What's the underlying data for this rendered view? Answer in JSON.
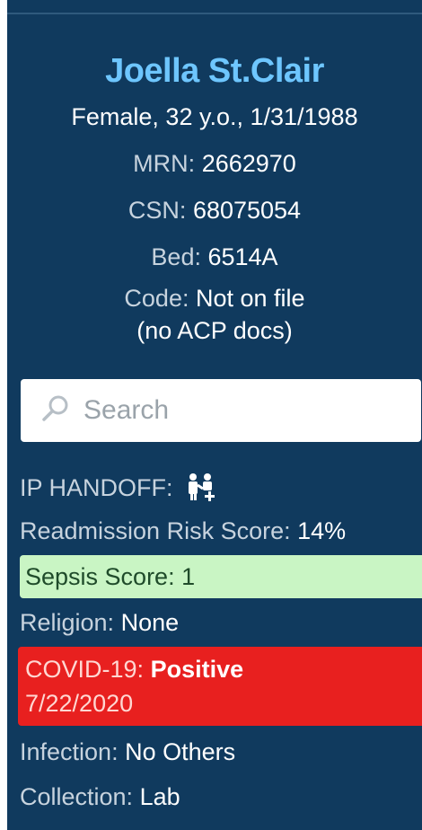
{
  "patient": {
    "name": "Joella St.Clair",
    "demographics": "Female, 32 y.o., 1/31/1988",
    "mrn_label": "MRN:",
    "mrn": "2662970",
    "csn_label": "CSN:",
    "csn": "68075054",
    "bed_label": "Bed:",
    "bed": "6514A",
    "code_label": "Code:",
    "code": "Not on file",
    "code_note": "(no ACP docs)"
  },
  "search": {
    "placeholder": "Search",
    "icon": "search-icon"
  },
  "info": {
    "handoff_label": "IP HANDOFF:",
    "handoff_icon": "handoff-icon",
    "readmission_label": "Readmission Risk Score:",
    "readmission_value": "14%",
    "sepsis_label": "Sepsis Score:",
    "sepsis_value": "1",
    "religion_label": "Religion:",
    "religion_value": "None",
    "covid_label": "COVID-19:",
    "covid_value": "Positive",
    "covid_date": "7/22/2020",
    "infection_label": "Infection:",
    "infection_value": "No Others",
    "collection_label": "Collection:",
    "collection_value": "Lab"
  },
  "colors": {
    "panel_bg": "#103a5e",
    "name_accent": "#6ec6ff",
    "sepsis_bg": "#c9f5c4",
    "covid_bg": "#e8201f"
  }
}
